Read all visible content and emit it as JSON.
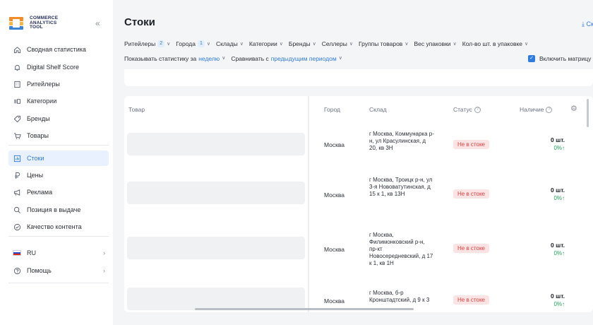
{
  "logo": {
    "line1": "COMMERCE",
    "line2": "ANALYTICS",
    "line3": "TOOL"
  },
  "sidebar": {
    "collapse_icon": "«",
    "items": [
      {
        "label": "Сводная статистика",
        "icon": "home-icon"
      },
      {
        "label": "Digital Shelf Score",
        "icon": "bell-icon"
      },
      {
        "label": "Ритейлеры",
        "icon": "building-icon"
      },
      {
        "label": "Категории",
        "icon": "categories-icon"
      },
      {
        "label": "Бренды",
        "icon": "tag-icon"
      },
      {
        "label": "Товары",
        "icon": "cart-icon"
      },
      {
        "label": "Стоки",
        "icon": "chart-icon",
        "active": true
      },
      {
        "label": "Цены",
        "icon": "ruble-icon"
      },
      {
        "label": "Реклама",
        "icon": "megaphone-icon"
      },
      {
        "label": "Позиция в выдаче",
        "icon": "search-icon"
      },
      {
        "label": "Качество контента",
        "icon": "check-circle-icon"
      }
    ],
    "language": "RU",
    "help": "Помощь"
  },
  "header": {
    "title": "Стоки",
    "download": "Скачат"
  },
  "filters": [
    {
      "label": "Ритейлеры",
      "badge": "2"
    },
    {
      "label": "Города",
      "badge": "1"
    },
    {
      "label": "Склады"
    },
    {
      "label": "Категории"
    },
    {
      "label": "Бренды"
    },
    {
      "label": "Селлеры"
    },
    {
      "label": "Группы товаров"
    },
    {
      "label": "Вес упаковки"
    },
    {
      "label": "Кол-во шт. в упаковке"
    }
  ],
  "stats": {
    "show_label": "Показывать статистику за",
    "period": "неделю",
    "compare_label": "Сравнивать с",
    "compare_value": "предыдущим периодом",
    "matrix_label": "Включить матрицу"
  },
  "table": {
    "columns": {
      "product": "Товар",
      "city": "Город",
      "warehouse": "Склад",
      "status": "Статус",
      "stock": "Наличие"
    },
    "rows": [
      {
        "city": "Москва",
        "warehouse": "г Москва, Коммунарка р-н, ул Красулинская, д 20, кв 3Н",
        "status": "Не в стоке",
        "qty": "0 шт.",
        "pct": "0%↑"
      },
      {
        "city": "Москва",
        "warehouse": "г Москва, Троицк р-н, ул 3-я Нововатутинская, д 15 к 1, кв 13Н",
        "status": "Не в стоке",
        "qty": "0 шт.",
        "pct": "0%↑"
      },
      {
        "city": "Москва",
        "warehouse": "г Москва, Филимонковский р-н, пр-кт Новосередневский, д 17 к 1, кв 1Н",
        "status": "Не в стоке",
        "qty": "0 шт.",
        "pct": "0%↑"
      },
      {
        "city": "Москва",
        "warehouse": "г Москва, б-р Кронштадтский, д 9 к 3",
        "status": "Не в стоке",
        "qty": "0 шт.",
        "pct": "0%↑"
      }
    ]
  }
}
